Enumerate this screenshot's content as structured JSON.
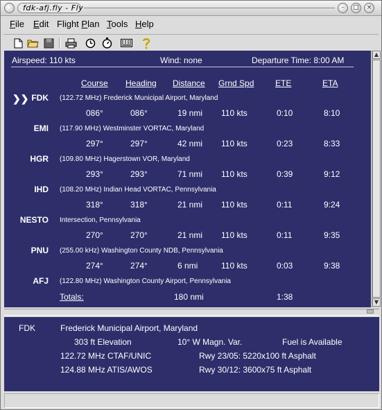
{
  "window": {
    "title": "fdk-afj.fly - Fly"
  },
  "menubar": [
    {
      "label": "File",
      "u": "F",
      "rest": "ile"
    },
    {
      "label": "Edit",
      "u": "E",
      "rest": "dit"
    },
    {
      "label": "Flight Plan",
      "pre": "Flight ",
      "u": "P",
      "rest": "lan"
    },
    {
      "label": "Tools",
      "u": "T",
      "rest": "ools"
    },
    {
      "label": "Help",
      "u": "H",
      "rest": "elp"
    }
  ],
  "toolbar_icons": [
    "new-file-icon",
    "open-folder-icon",
    "save-icon",
    "print-icon",
    "clock-icon",
    "stopwatch-icon",
    "keypad-icon",
    "help-icon"
  ],
  "header": {
    "airspeed": "Airspeed: 110 kts",
    "wind": "Wind: none",
    "departure": "Departure Time:  8:00 AM"
  },
  "columns": [
    "Course",
    "Heading",
    "Distance",
    "Grnd Spd",
    "ETE",
    "ETA"
  ],
  "current_marker": "❯❯",
  "waypoints": [
    {
      "id": "FDK",
      "desc": "(122.72 MHz) Frederick Municipal Airport, Maryland"
    },
    {
      "id": "EMI",
      "desc": "(117.90 MHz) Westminster VORTAC, Maryland"
    },
    {
      "id": "HGR",
      "desc": "(109.80 MHz) Hagerstown VOR, Maryland"
    },
    {
      "id": "IHD",
      "desc": "(108.20 MHz) Indian Head VORTAC, Pennsylvania"
    },
    {
      "id": "NESTO",
      "desc": "Intersection, Pennsylvania"
    },
    {
      "id": "PNU",
      "desc": "(255.00 kHz) Washington County NDB, Pennsylvania"
    },
    {
      "id": "AFJ",
      "desc": "(122.80 MHz) Washington County Airport, Pennsylvania"
    }
  ],
  "legs": [
    [
      "086°",
      "086°",
      "19 nmi",
      "110 kts",
      "0:10",
      "8:10"
    ],
    [
      "297°",
      "297°",
      "42 nmi",
      "110 kts",
      "0:23",
      "8:33"
    ],
    [
      "293°",
      "293°",
      "71 nmi",
      "110 kts",
      "0:39",
      "9:12"
    ],
    [
      "318°",
      "318°",
      "21 nmi",
      "110 kts",
      "0:11",
      "9:24"
    ],
    [
      "270°",
      "270°",
      "21 nmi",
      "110 kts",
      "0:11",
      "9:35"
    ],
    [
      "274°",
      "274°",
      "6 nmi",
      "110 kts",
      "0:03",
      "9:38"
    ]
  ],
  "totals": {
    "label": "Totals:",
    "distance": "180 nmi",
    "ete": "1:38"
  },
  "info": {
    "id": "FDK",
    "name": "Frederick Municipal Airport, Maryland",
    "elevation": "303 ft Elevation",
    "magvar": "10° W Magn. Var.",
    "fuel": "Fuel is Available",
    "freq1": "122.72 MHz CTAF/UNIC",
    "freq2": "124.88 MHz ATIS/AWOS",
    "rwy1": "Rwy 23/05:  5220x100 ft Asphalt",
    "rwy2": "Rwy 30/12:  3600x75 ft Asphalt"
  }
}
